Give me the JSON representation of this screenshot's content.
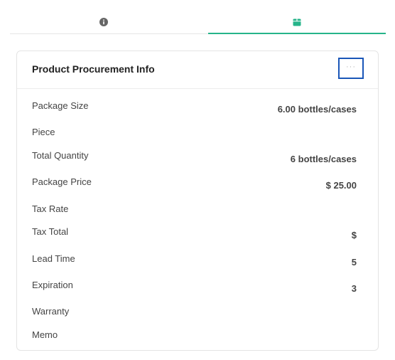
{
  "tabs": [
    {
      "icon": "info-icon",
      "active": false
    },
    {
      "icon": "box-icon",
      "active": true
    }
  ],
  "colors": {
    "accent": "#26b48a",
    "focus_outline": "#1a56b8"
  },
  "card": {
    "title": "Product Procurement Info",
    "more_label": "···",
    "rows": [
      {
        "label": "Package Size",
        "value": "6.00 bottles/cases"
      },
      {
        "label": "Piece",
        "value": ""
      },
      {
        "label": "Total Quantity",
        "value": "6 bottles/cases"
      },
      {
        "label": "Package Price",
        "value": "$ 25.00"
      },
      {
        "label": "Tax Rate",
        "value": ""
      },
      {
        "label": "Tax Total",
        "value": "$"
      },
      {
        "label": "Lead Time",
        "value": "5"
      },
      {
        "label": "Expiration",
        "value": "3"
      },
      {
        "label": "Warranty",
        "value": ""
      },
      {
        "label": "Memo",
        "value": ""
      }
    ]
  }
}
